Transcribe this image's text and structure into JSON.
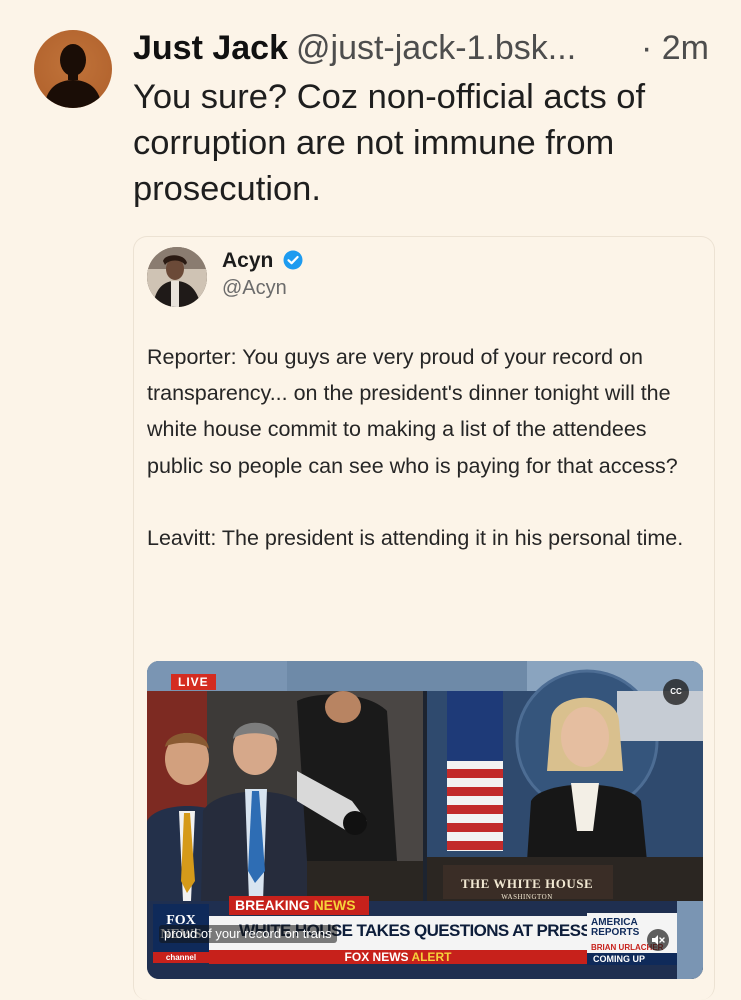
{
  "post": {
    "author_name": "Just Jack",
    "author_handle": "@just-jack-1.bsk...",
    "time": "· 2m",
    "text": "You sure? Coz non-official acts of corruption are not immune from prosecution."
  },
  "quote": {
    "author_name": "Acyn",
    "author_handle": "@Acyn",
    "verified": true,
    "paragraph_1": "Reporter: You guys are very proud of your record on transparency... on the president's dinner tonight will the white house commit to making a list of the attendees public so people can see who is paying for that access?",
    "paragraph_2": "Leavitt: The president is attending it in his personal time."
  },
  "video": {
    "live_label": "LIVE",
    "cc_label": "CC",
    "podium_title": "THE WHITE HOUSE",
    "podium_subtitle": "WASHINGTON",
    "breaking_label": "BREAKING ",
    "breaking_news": "NEWS",
    "headline": "WHITE HOUSE TAKES QUESTIONS AT PRESS BRIEFING",
    "logo_text": "FOX NEWS",
    "channel_label": "channel",
    "alert_prefix": "FOX NEWS ",
    "alert_word": "ALERT",
    "caption": "proud of your record on trans",
    "promo_title": "AMERICA REPORTS",
    "promo_name": "BRIAN URLACHER",
    "promo_coming": "COMING UP"
  },
  "colors": {
    "background": "#fcf4e8",
    "verified_badge": "#1d9bf0",
    "fox_red": "#c7211b",
    "fox_navy": "#0f2a5a"
  }
}
